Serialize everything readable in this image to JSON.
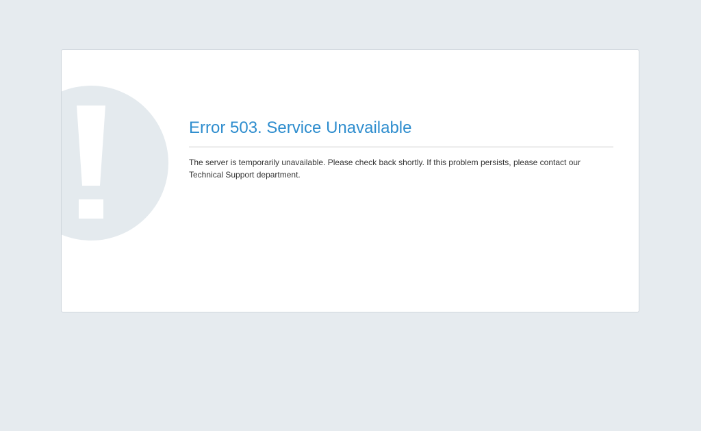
{
  "page": {
    "background_color": "#e6ebef"
  },
  "error": {
    "title": "Error 503. Service Unavailable",
    "message": "The server is temporarily unavailable. Please check back shortly. If this problem persists, please contact our Technical Support department.",
    "title_color": "#2e8dce",
    "icon": "exclamation-icon",
    "icon_colors": {
      "circle": "#e4eaee",
      "mark": "#ffffff"
    }
  }
}
